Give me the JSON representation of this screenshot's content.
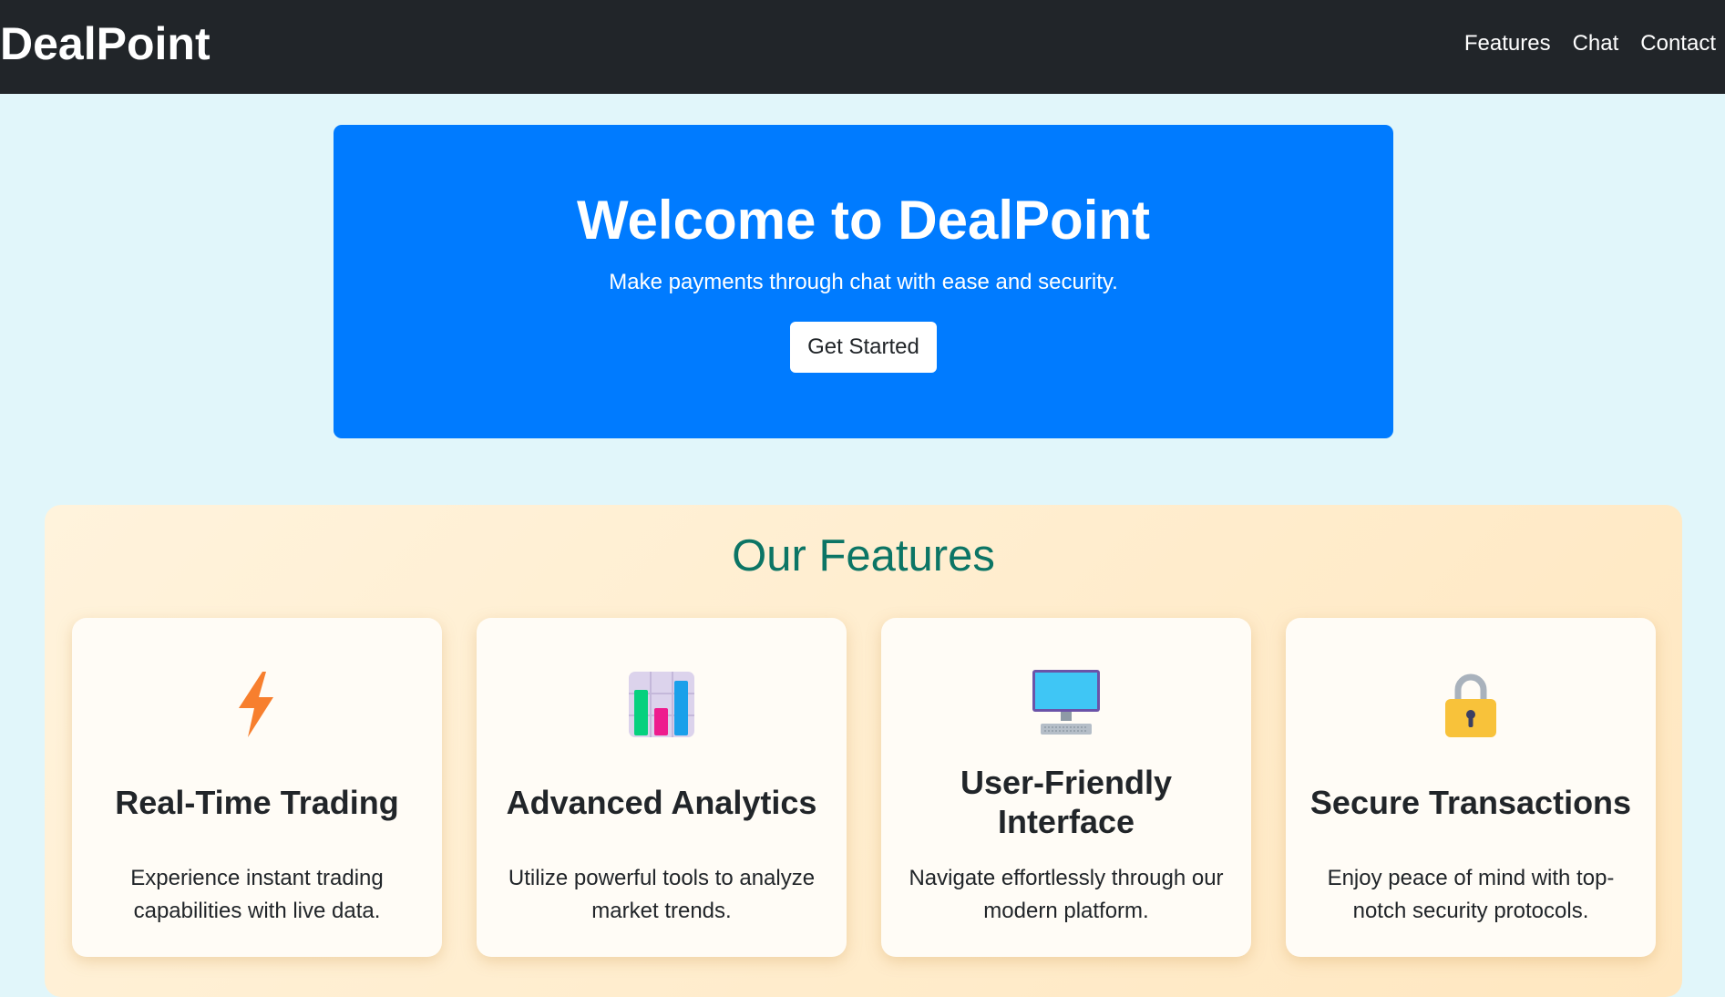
{
  "navbar": {
    "brand": "DealPoint",
    "links": [
      {
        "label": "Features"
      },
      {
        "label": "Chat"
      },
      {
        "label": "Contact"
      }
    ]
  },
  "hero": {
    "title": "Welcome to DealPoint",
    "subtitle": "Make payments through chat with ease and security.",
    "button_label": "Get Started",
    "background_color": "#007bff"
  },
  "features": {
    "title": "Our Features",
    "cards": [
      {
        "icon": "lightning-icon",
        "title": "Real-Time Trading",
        "description": "Experience instant trading capabilities with live data."
      },
      {
        "icon": "bar-chart-icon",
        "title": "Advanced Analytics",
        "description": "Utilize powerful tools to analyze market trends."
      },
      {
        "icon": "computer-icon",
        "title": "User-Friendly Interface",
        "description": "Navigate effortlessly through our modern platform."
      },
      {
        "icon": "lock-icon",
        "title": "Secure Transactions",
        "description": "Enjoy peace of mind with top-notch security protocols."
      }
    ]
  },
  "colors": {
    "navbar": "#212529",
    "page_background": "#e1f6fa",
    "features_title": "#0c7565"
  }
}
